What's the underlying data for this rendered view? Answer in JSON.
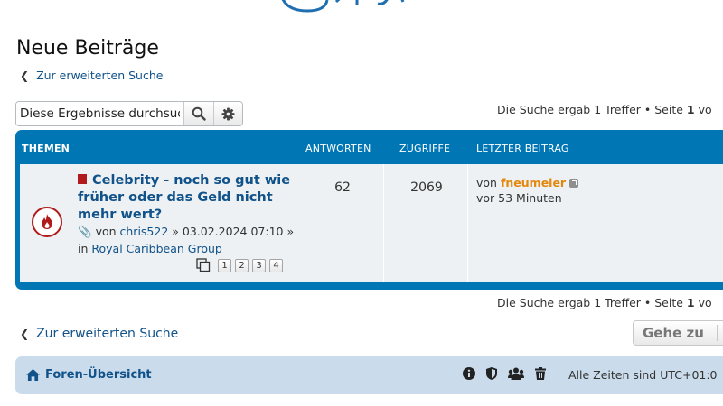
{
  "page": {
    "title": "Neue Beiträge",
    "back_link": "Zur erweiterten Suche",
    "back_link_bottom": "Zur erweiterten Suche"
  },
  "search": {
    "placeholder": "Diese Ergebnisse durchsuchen",
    "search_icon": "search-icon",
    "settings_icon": "gear-icon"
  },
  "pagination": {
    "prefix": "Die Suche ergab 1 Treffer • Seite",
    "current_page": "1",
    "suffix": "vo"
  },
  "table": {
    "headers": {
      "topics": "THEMEN",
      "replies": "ANTWORTEN",
      "views": "ZUGRIFFE",
      "last_post": "LETZTER BEITRAG"
    },
    "rows": [
      {
        "title": "Celebrity - noch so gut wie früher oder das Geld nicht mehr wert?",
        "by_label": "von",
        "author": "chris522",
        "date": "» 03.02.2024 07:10 » in",
        "forum": "Royal Caribbean Group",
        "pages": [
          "1",
          "2",
          "3",
          "4"
        ],
        "replies": "62",
        "views": "2069",
        "last_by_label": "von",
        "last_user": "fneumeier",
        "last_time": "vor 53 Minuten"
      }
    ]
  },
  "jump": {
    "label": "Gehe zu"
  },
  "footer": {
    "home_label": "Foren-Übersicht",
    "timezone": "Alle Zeiten sind UTC+01:0"
  },
  "colors": {
    "header_blue": "#0076b4",
    "link_blue": "#105289",
    "user_orange": "#e4870d",
    "hot_red": "#b11a1a",
    "navbar_bg": "#cadceb"
  }
}
